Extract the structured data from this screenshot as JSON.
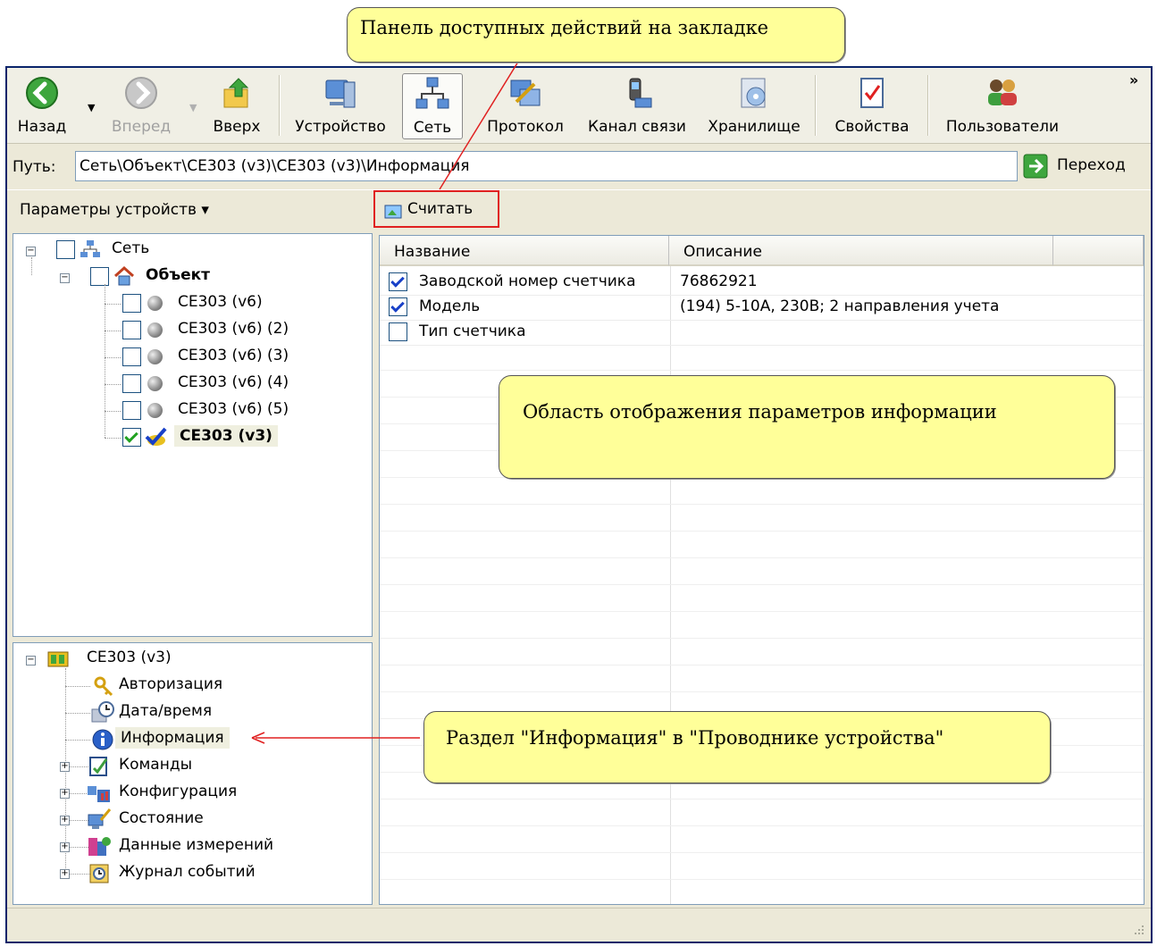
{
  "callouts": {
    "toolbar_panel": "Панель доступных действий на закладке",
    "display_area": "Область отображения параметров информации",
    "info_section": "Раздел \"Информация\" в \"Проводнике устройства\""
  },
  "toolbar": {
    "back": "Назад",
    "forward": "Вперед",
    "up": "Вверх",
    "device": "Устройство",
    "network": "Сеть",
    "protocol": "Протокол",
    "channel": "Канал связи",
    "storage": "Хранилище",
    "properties": "Свойства",
    "users": "Пользователи",
    "overflow": "»"
  },
  "pathbar": {
    "label": "Путь:",
    "value": "Сеть\\Объект\\CE303 (v3)\\CE303 (v3)\\Информация",
    "go": "Переход"
  },
  "params_dropdown": "Параметры устройств ▾",
  "read_button": "Считать",
  "network_tree": {
    "root": "Сеть",
    "object": "Объект",
    "devices": [
      "CE303 (v6)",
      "CE303 (v6) (2)",
      "CE303 (v6) (3)",
      "CE303 (v6) (4)",
      "CE303 (v6) (5)"
    ],
    "selected_device": "CE303 (v3)"
  },
  "device_tree": {
    "root": "CE303 (v3)",
    "items": [
      "Авторизация",
      "Дата/время",
      "Информация",
      "Команды",
      "Конфигурация",
      "Состояние",
      "Данные измерений",
      "Журнал событий"
    ]
  },
  "grid": {
    "columns": [
      "Название",
      "Описание"
    ],
    "rows": [
      {
        "checked": true,
        "name": "Заводской номер счетчика",
        "value": "76862921"
      },
      {
        "checked": true,
        "name": "Модель",
        "value": "(194) 5-10А, 230В; 2 направления учета"
      },
      {
        "checked": false,
        "name": "Тип счетчика",
        "value": ""
      }
    ]
  },
  "colors": {
    "callout_fill": "#ffff99",
    "highlight_red": "#e02020",
    "window_bg": "#ece9d8"
  }
}
